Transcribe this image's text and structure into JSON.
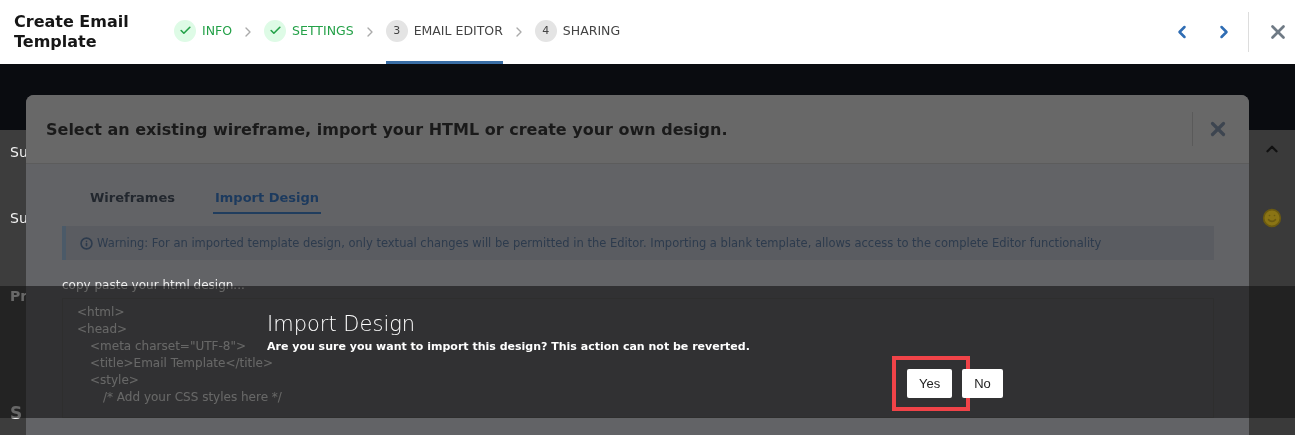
{
  "header": {
    "title": "Create Email Template",
    "steps": [
      {
        "label": "INFO",
        "done": true,
        "selected": false
      },
      {
        "label": "SETTINGS",
        "done": true,
        "selected": false
      },
      {
        "number": "3",
        "label": "EMAIL EDITOR",
        "done": false,
        "selected": true
      },
      {
        "number": "4",
        "label": "SHARING",
        "done": false,
        "selected": false
      }
    ]
  },
  "background_fragments": [
    "Su",
    "Su",
    "Pr",
    "S"
  ],
  "modal": {
    "title": "Select an existing wireframe, import your HTML or create your own design.",
    "tabs": [
      {
        "label": "Wireframes",
        "selected": false
      },
      {
        "label": "Import Design",
        "selected": true
      }
    ],
    "warning": "Warning: For an imported template design, only textual changes will be permitted in the Editor. Importing a blank template, allows access to the complete Editor functionality",
    "code_label": "copy paste your html design...",
    "code_lines": [
      {
        "text": "<html>"
      },
      {
        "text": "<head>",
        "children": [
          {
            "text": "<meta charset=\"UTF-8\">"
          },
          {
            "text": "<title>Email Template</title>"
          },
          {
            "text": "<style>",
            "children": [
              {
                "text": "/* Add your CSS styles here */"
              }
            ]
          }
        ]
      }
    ]
  },
  "confirm": {
    "title": "Import Design",
    "message": "Are you sure you want to import this design? This action can not be reverted.",
    "buttons": [
      {
        "label": "Yes",
        "highlighted": true
      },
      {
        "label": "No",
        "highlighted": false
      }
    ]
  }
}
